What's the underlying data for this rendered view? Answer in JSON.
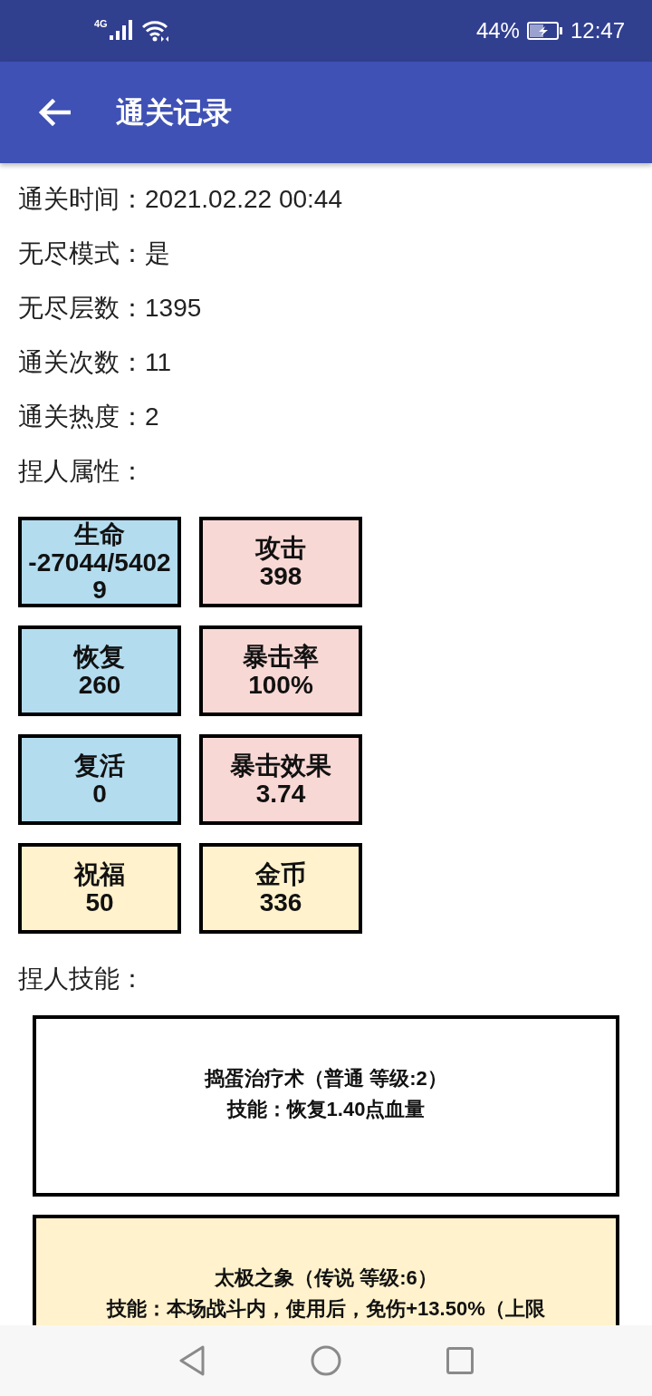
{
  "status_bar": {
    "network": "4G",
    "battery": "44%",
    "time": "12:47"
  },
  "app_bar": {
    "title": "通关记录"
  },
  "record": {
    "rows": [
      "通关时间：2021.02.22 00:44",
      "无尽模式：是",
      "无尽层数：1395",
      "通关次数：11",
      "通关热度：2"
    ]
  },
  "attributes": {
    "heading": "捏人属性：",
    "tiles": [
      {
        "label": "生命",
        "value": "-27044/54029",
        "color": "#b3dcef"
      },
      {
        "label": "攻击",
        "value": "398",
        "color": "#f8d8d5"
      },
      {
        "label": "恢复",
        "value": "260",
        "color": "#b3dcef"
      },
      {
        "label": "暴击率",
        "value": "100%",
        "color": "#f8d8d5"
      },
      {
        "label": "复活",
        "value": "0",
        "color": "#b3dcef"
      },
      {
        "label": "暴击效果",
        "value": "3.74",
        "color": "#f8d8d5"
      },
      {
        "label": "祝福",
        "value": "50",
        "color": "#fff2cc"
      },
      {
        "label": "金币",
        "value": "336",
        "color": "#fff2cc"
      }
    ]
  },
  "skills": {
    "heading": "捏人技能：",
    "cards": [
      {
        "title": "捣蛋治疗术（普通 等级:2）",
        "description": "技能：恢复1.40点血量",
        "color": "#ffffff"
      },
      {
        "title": "太极之象（传说 等级:6）",
        "description": "技能：本场战斗内，使用后，免伤+13.50%（上限",
        "color": "#fff2cc"
      }
    ]
  }
}
